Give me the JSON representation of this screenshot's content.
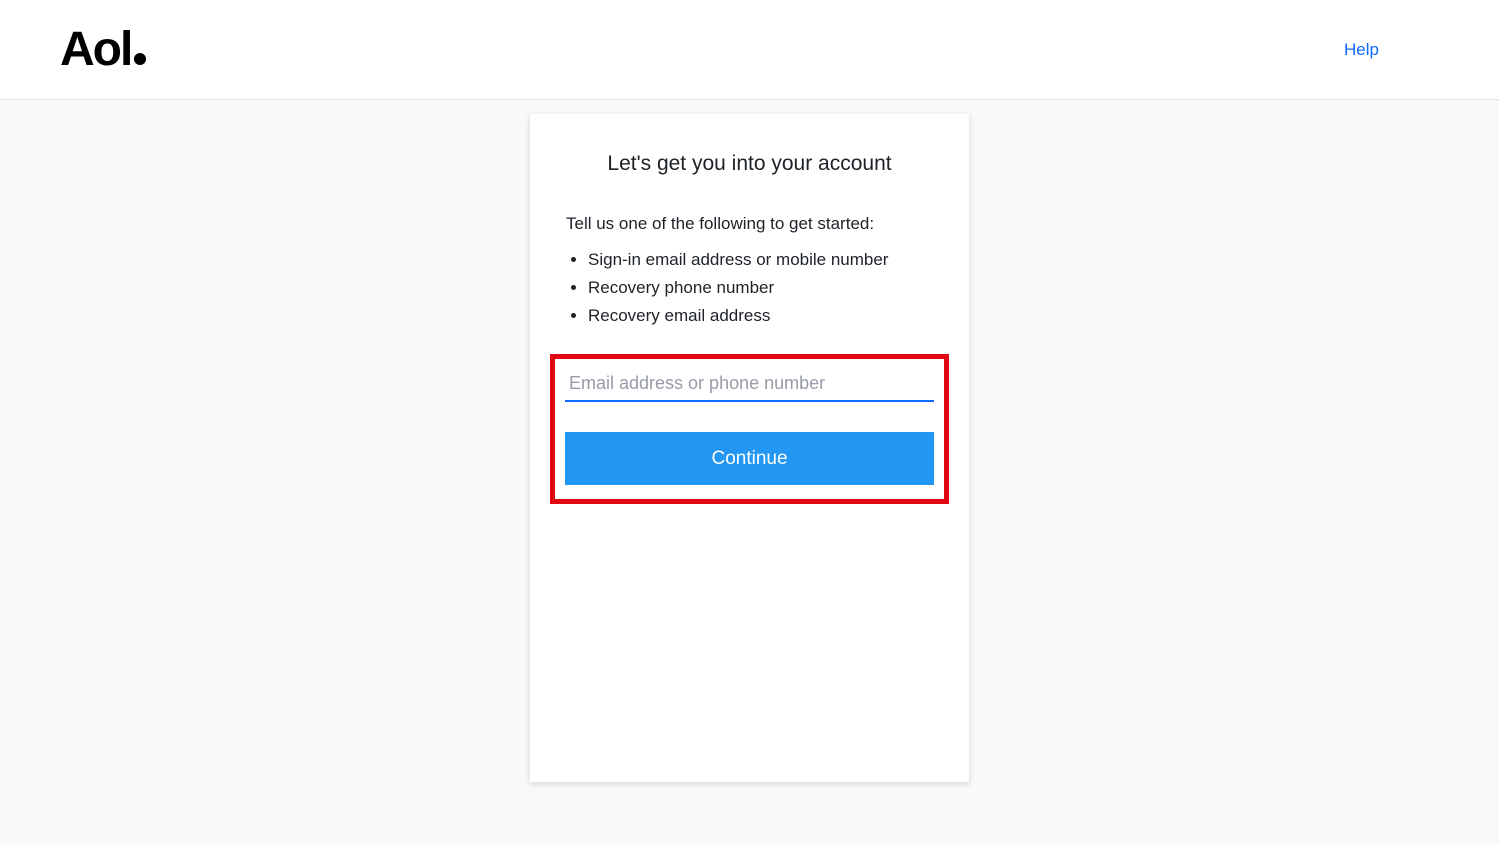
{
  "header": {
    "logo_text": "Aol",
    "help_label": "Help"
  },
  "card": {
    "title": "Let's get you into your account",
    "instruction": "Tell us one of the following to get started:",
    "options": [
      "Sign-in email address or mobile number",
      "Recovery phone number",
      "Recovery email address"
    ],
    "input_placeholder": "Email address or phone number",
    "input_value": "",
    "continue_label": "Continue"
  }
}
